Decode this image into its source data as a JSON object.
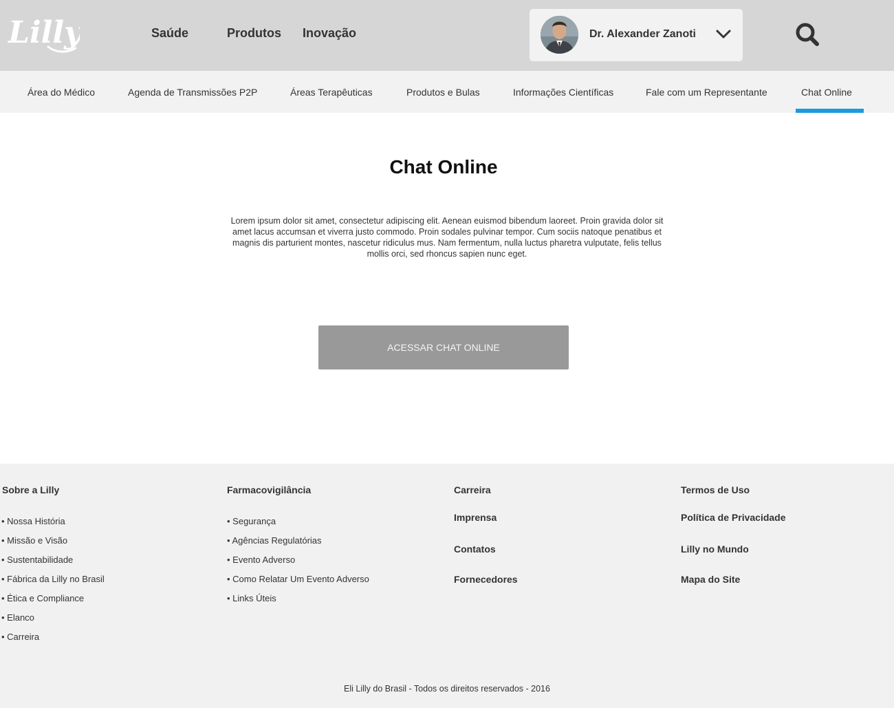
{
  "header": {
    "logo_text": "Lilly",
    "nav": [
      "Saúde",
      "Produtos",
      "Inovação"
    ],
    "user": {
      "name": "Dr. Alexander Zanoti"
    }
  },
  "subnav": {
    "items": [
      "Área do Médico",
      "Agenda de Transmissões P2P",
      "Áreas Terapêuticas",
      "Produtos e Bulas",
      "Informações Científicas",
      "Fale com um Representante",
      "Chat Online"
    ],
    "active": "Chat Online"
  },
  "main": {
    "title": "Chat Online",
    "intro": "Lorem ipsum dolor sit amet, consectetur adipiscing elit. Aenean euismod bibendum laoreet. Proin gravida dolor sit amet lacus accumsan et viverra justo commodo. Proin sodales pulvinar tempor. Cum sociis natoque penatibus et magnis dis parturient montes, nascetur ridiculus mus. Nam fermentum, nulla luctus pharetra vulputate, felis tellus mollis orci, sed rhoncus sapien nunc eget.",
    "button_label": "ACESSAR CHAT ONLINE"
  },
  "footer": {
    "col1": {
      "heading": "Sobre a Lilly",
      "links": [
        "• Nossa História",
        "• Missão e Visão",
        "• Sustentabilidade",
        "• Fábrica da Lilly no Brasil",
        "• Ética e Compliance",
        "• Elanco",
        "• Carreira"
      ]
    },
    "col2": {
      "heading": "Farmacovigilância",
      "links": [
        "• Segurança",
        "• Agências Regulatórias",
        "• Evento Adverso",
        "• Como Relatar Um Evento Adverso",
        "• Links Úteis"
      ]
    },
    "col3": [
      "Carreira",
      "Imprensa",
      "Contatos",
      "Fornecedores"
    ],
    "col4": [
      "Termos de Uso",
      "Política de Privacidade",
      "Lilly no Mundo",
      "Mapa do Site"
    ],
    "copyright": "Eli Lilly do Brasil - Todos os direitos reservados - 2016"
  },
  "colors": {
    "header_bg": "#d6d6d6",
    "subnav_bg": "#f2f2f2",
    "active_tab": "#1a9bdc",
    "button_bg": "#999999",
    "footer_bg": "#f1f1f1"
  },
  "icons": [
    "lilly-logo",
    "user-avatar",
    "chevron-down-icon",
    "search-icon"
  ]
}
